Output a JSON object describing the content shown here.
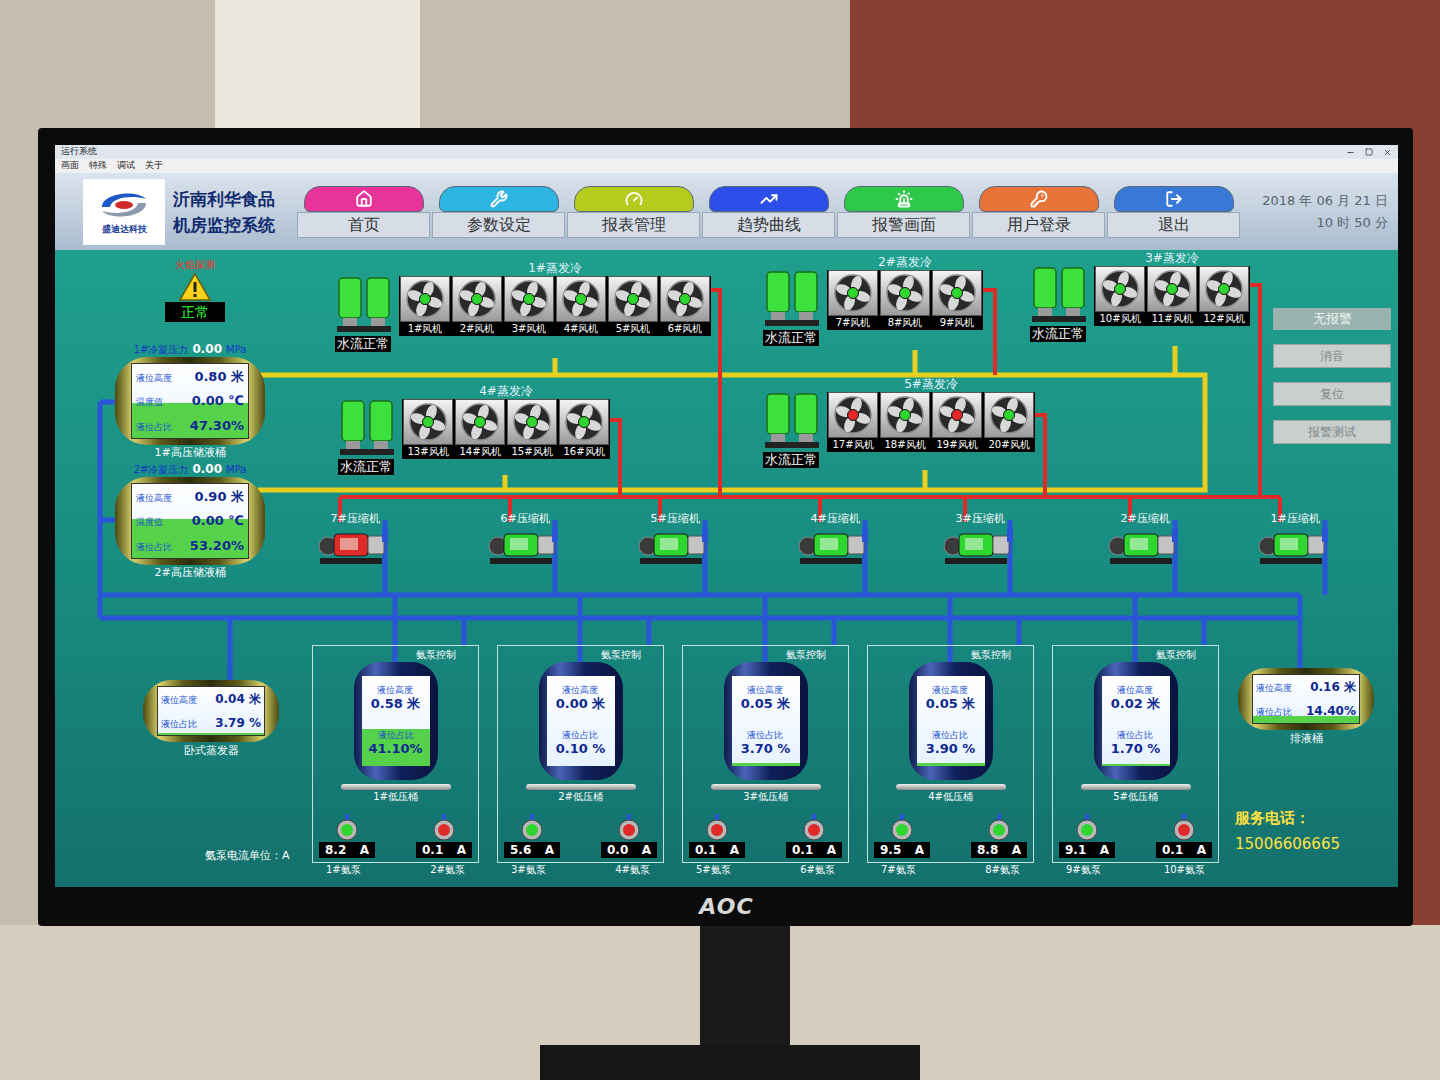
{
  "window": {
    "title": "运行系统",
    "menu": [
      "画面",
      "特殊",
      "调试",
      "关于"
    ]
  },
  "header": {
    "logo": "盛迪达科技",
    "title": [
      "沂南利华食品",
      "机房监控系统"
    ],
    "nav": [
      {
        "label": "首页",
        "color": "#e8349a"
      },
      {
        "label": "参数设定",
        "color": "#2bb5e0"
      },
      {
        "label": "报表管理",
        "color": "#b5cc1f"
      },
      {
        "label": "趋势曲线",
        "color": "#2b4fe8"
      },
      {
        "label": "报警画面",
        "color": "#2fc94a"
      },
      {
        "label": "用户登录",
        "color": "#e8743a"
      },
      {
        "label": "退出",
        "color": "#3a78d8"
      }
    ],
    "date": "2018 年 06 月 21 日",
    "time": "10 时 50 分"
  },
  "fire": {
    "label": "火焰探测",
    "status": "正常"
  },
  "receivers": [
    {
      "pressureLabel": "1#冷凝压力",
      "pressure": "0.00",
      "pressureUnit": "MPa",
      "rows": [
        {
          "label": "液位高度",
          "value": "0.80 米"
        },
        {
          "label": "温度值",
          "value": "0.00 ℃"
        },
        {
          "label": "液位占比",
          "value": "47.30%"
        }
      ],
      "level": 0.473,
      "name": "1#高压储液桶"
    },
    {
      "pressureLabel": "2#冷凝压力",
      "pressure": "0.00",
      "pressureUnit": "MPa",
      "rows": [
        {
          "label": "液位高度",
          "value": "0.90 米"
        },
        {
          "label": "温度值",
          "value": "0.00 ℃"
        },
        {
          "label": "液位占比",
          "value": "53.20%"
        }
      ],
      "level": 0.532,
      "name": "2#高压储液桶"
    }
  ],
  "condensers": [
    {
      "title": "1#蒸发冷",
      "water": "水流正常",
      "fans": [
        {
          "label": "1#风机",
          "running": true
        },
        {
          "label": "2#风机",
          "running": true
        },
        {
          "label": "3#风机",
          "running": true
        },
        {
          "label": "4#风机",
          "running": true
        },
        {
          "label": "5#风机",
          "running": true
        },
        {
          "label": "6#风机",
          "running": true
        }
      ]
    },
    {
      "title": "2#蒸发冷",
      "water": "水流正常",
      "fans": [
        {
          "label": "7#风机",
          "running": true
        },
        {
          "label": "8#风机",
          "running": true
        },
        {
          "label": "9#风机",
          "running": true
        }
      ]
    },
    {
      "title": "3#蒸发冷",
      "water": "水流正常",
      "fans": [
        {
          "label": "10#风机",
          "running": true
        },
        {
          "label": "11#风机",
          "running": true
        },
        {
          "label": "12#风机",
          "running": true
        }
      ]
    },
    {
      "title": "4#蒸发冷",
      "water": "水流正常",
      "fans": [
        {
          "label": "13#风机",
          "running": true
        },
        {
          "label": "14#风机",
          "running": true
        },
        {
          "label": "15#风机",
          "running": true
        },
        {
          "label": "16#风机",
          "running": true
        }
      ]
    },
    {
      "title": "5#蒸发冷",
      "water": "水流正常",
      "fans": [
        {
          "label": "17#风机",
          "running": false
        },
        {
          "label": "18#风机",
          "running": true
        },
        {
          "label": "19#风机",
          "running": false
        },
        {
          "label": "20#风机",
          "running": true
        }
      ]
    }
  ],
  "compressors": [
    {
      "label": "7#压缩机",
      "running": false
    },
    {
      "label": "6#压缩机",
      "running": true
    },
    {
      "label": "5#压缩机",
      "running": true
    },
    {
      "label": "4#压缩机",
      "running": true
    },
    {
      "label": "3#压缩机",
      "running": true
    },
    {
      "label": "2#压缩机",
      "running": true
    },
    {
      "label": "1#压缩机",
      "running": true
    }
  ],
  "alarm": {
    "status": "无报警",
    "buttons": [
      "消音",
      "复位",
      "报警测试"
    ]
  },
  "evaporator": {
    "name": "卧式蒸发器",
    "rows": [
      {
        "label": "液位高度",
        "value": "0.04 米"
      },
      {
        "label": "液位占比",
        "value": "3.79 %"
      }
    ],
    "level": 0.0379
  },
  "lowBarrels": [
    {
      "control": "氨泵控制",
      "name": "1#低压桶",
      "rows": [
        {
          "label": "液位高度",
          "value": "0.58 米"
        },
        {
          "label": "液位占比",
          "value": "41.10%"
        }
      ],
      "level": 0.411,
      "pumps": [
        {
          "label": "1#氨泵",
          "current": "8.2",
          "unit": "A",
          "running": true
        },
        {
          "label": "2#氨泵",
          "current": "0.1",
          "unit": "A",
          "running": false
        }
      ]
    },
    {
      "control": "氨泵控制",
      "name": "2#低压桶",
      "rows": [
        {
          "label": "液位高度",
          "value": "0.00 米"
        },
        {
          "label": "液位占比",
          "value": "0.10 %"
        }
      ],
      "level": 0.001,
      "pumps": [
        {
          "label": "3#氨泵",
          "current": "5.6",
          "unit": "A",
          "running": true
        },
        {
          "label": "4#氨泵",
          "current": "0.0",
          "unit": "A",
          "running": false
        }
      ]
    },
    {
      "control": "氨泵控制",
      "name": "3#低压桶",
      "rows": [
        {
          "label": "液位高度",
          "value": "0.05 米"
        },
        {
          "label": "液位占比",
          "value": "3.70 %"
        }
      ],
      "level": 0.037,
      "pumps": [
        {
          "label": "5#氨泵",
          "current": "0.1",
          "unit": "A",
          "running": false
        },
        {
          "label": "6#氨泵",
          "current": "0.1",
          "unit": "A",
          "running": false
        }
      ]
    },
    {
      "control": "氨泵控制",
      "name": "4#低压桶",
      "rows": [
        {
          "label": "液位高度",
          "value": "0.05 米"
        },
        {
          "label": "液位占比",
          "value": "3.90 %"
        }
      ],
      "level": 0.039,
      "pumps": [
        {
          "label": "7#氨泵",
          "current": "9.5",
          "unit": "A",
          "running": true
        },
        {
          "label": "8#氨泵",
          "current": "8.8",
          "unit": "A",
          "running": true
        }
      ]
    },
    {
      "control": "氨泵控制",
      "name": "5#低压桶",
      "rows": [
        {
          "label": "液位高度",
          "value": "0.02 米"
        },
        {
          "label": "液位占比",
          "value": "1.70 %"
        }
      ],
      "level": 0.017,
      "pumps": [
        {
          "label": "9#氨泵",
          "current": "9.1",
          "unit": "A",
          "running": true
        },
        {
          "label": "10#氨泵",
          "current": "0.1",
          "unit": "A",
          "running": false
        }
      ]
    }
  ],
  "drain": {
    "name": "排液桶",
    "rows": [
      {
        "label": "液位高度",
        "value": "0.16 米"
      },
      {
        "label": "液位占比",
        "value": "14.40%"
      }
    ],
    "level": 0.144
  },
  "currentUnit": "氨泵电流单位：A",
  "service": {
    "label": "服务电话：",
    "phone": "15006606665"
  },
  "monitor": {
    "brand": "AOC"
  }
}
